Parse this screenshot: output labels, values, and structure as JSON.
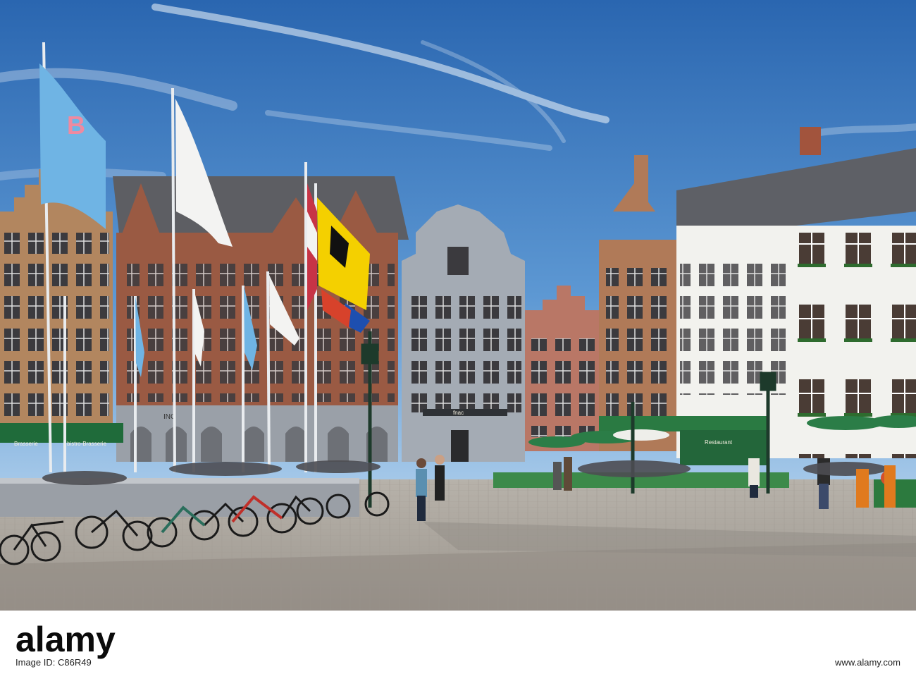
{
  "photo": {
    "description_labels": {
      "fnac_sign": "fnac",
      "bistro_sign": "bistro-Brasserie",
      "brasserie_sign": "Brasserie",
      "ing_sign": "ING",
      "flag_mark": "B",
      "restaurant_sign": "Restaurant"
    }
  },
  "watermark": {
    "brand": "alamy",
    "image_id_label": "Image ID:",
    "image_id": "C86R49",
    "url": "www.alamy.com"
  },
  "colors": {
    "sky_top": "#2f6fb7",
    "sky_bottom": "#9cc3e6",
    "brick": "#9a5a43",
    "gray_facade": "#a4abb4",
    "white_facade": "#f2f2ee",
    "awning_green": "#1f6b3a",
    "cobble": "#b9b4ad"
  }
}
